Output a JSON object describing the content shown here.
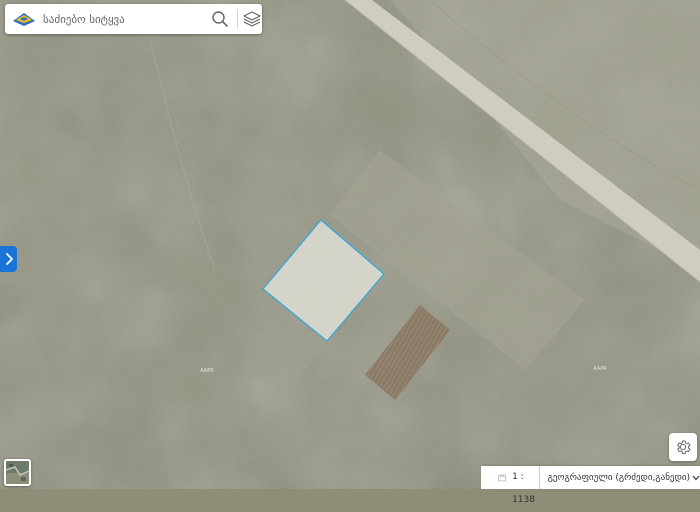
{
  "search": {
    "placeholder": "საძიებო სიტყვა",
    "search_icon": "search-icon",
    "layers_icon": "layers-icon",
    "logo_icon": "agency-logo-icon"
  },
  "side_panel": {
    "toggle_icon": "chevron-right-icon"
  },
  "map": {
    "labels": [
      {
        "text": "AAPR"
      },
      {
        "text": "AAPR"
      }
    ]
  },
  "footer": {
    "scale_label": "1 : 1138",
    "projection_label": "გეოგრაფიული (გრძედი,განედი)",
    "scale_icon": "scale-icon",
    "dropdown_icon": "chevron-down-icon"
  },
  "controls": {
    "settings_icon": "gear-icon"
  },
  "colors": {
    "selected_parcel_fill": "#d9d8ce",
    "selected_parcel_stroke": "#35a8d8",
    "accent": "#1a73d9"
  }
}
